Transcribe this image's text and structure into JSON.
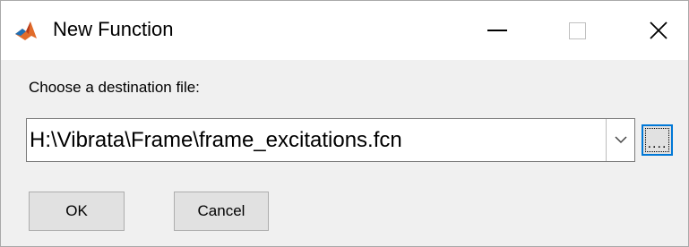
{
  "window": {
    "title": "New Function",
    "app_icon": "matlab-logo-icon",
    "controls": {
      "minimize": "minimize-icon",
      "maximize": "maximize-icon",
      "close": "close-icon",
      "close_glyph": "✕"
    }
  },
  "form": {
    "prompt": "Choose a destination file:",
    "destination_value": "H:\\Vibrata\\Frame\\frame_excitations.fcn",
    "dropdown_icon": "chevron-down-icon",
    "browse_label": "...."
  },
  "buttons": {
    "ok_label": "OK",
    "cancel_label": "Cancel"
  },
  "colors": {
    "accent_focus": "#0078d7",
    "titlebar_bg": "#ffffff",
    "dialog_bg": "#f0f0f0",
    "button_bg": "#e1e1e1"
  }
}
